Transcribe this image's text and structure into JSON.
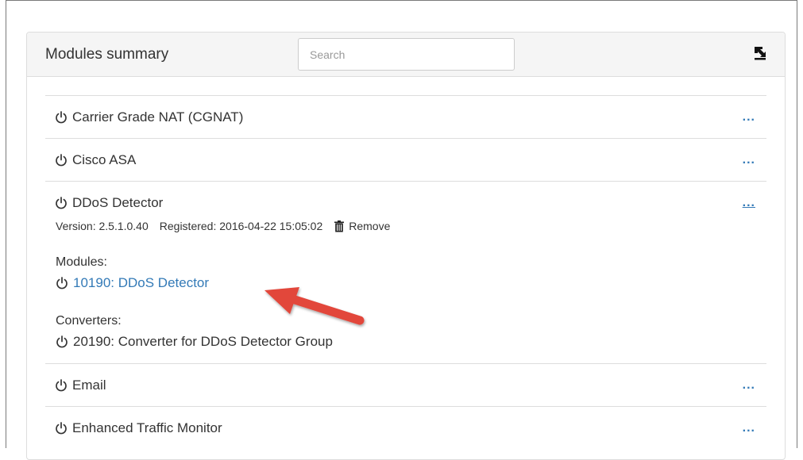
{
  "panel": {
    "title": "Modules summary",
    "search_placeholder": "Search",
    "export_icon": "export-download-icon"
  },
  "modules": [
    {
      "name": "Carrier Grade NAT (CGNAT)",
      "menu": "..."
    },
    {
      "name": "Cisco ASA",
      "menu": "..."
    },
    {
      "name": "DDoS Detector",
      "menu": "...",
      "version_text": "Version: 2.5.1.0.40",
      "registered_text": "Registered: 2016-04-22 15:05:02",
      "remove_label": "Remove",
      "modules_label": "Modules:",
      "module_link": "10190: DDoS Detector",
      "converters_label": "Converters:",
      "converter_item": "20190: Converter for DDoS Detector Group"
    },
    {
      "name": "Email",
      "menu": "..."
    },
    {
      "name": "Enhanced Traffic Monitor",
      "menu": "..."
    }
  ],
  "colors": {
    "link": "#337ab7",
    "arrow": "#e2463b",
    "header_bg": "#f5f5f5"
  }
}
